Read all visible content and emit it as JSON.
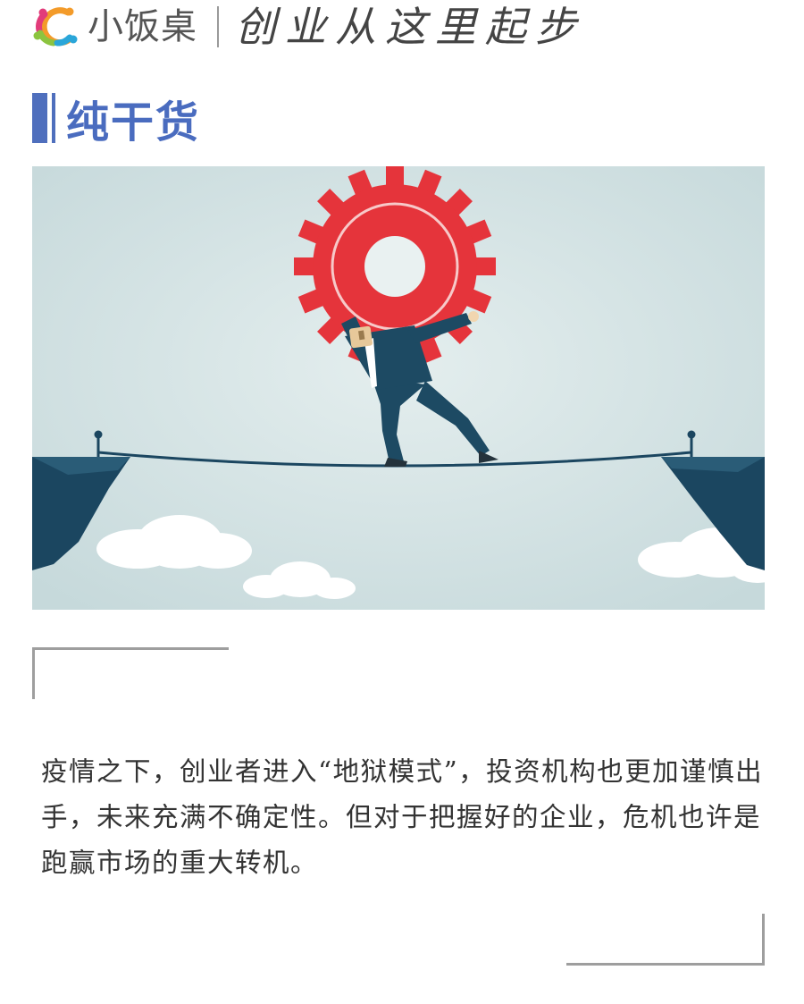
{
  "header": {
    "brand_name": "小饭桌",
    "slogan": "创业从这里起步",
    "logo_icon": "colorful-c-logo-icon"
  },
  "section": {
    "title": "纯干货"
  },
  "hero": {
    "icon": "businessman-carrying-gear-on-tightrope-illustration"
  },
  "article": {
    "paragraph": "疫情之下，创业者进入“地狱模式”，投资机构也更加谨慎出手，未来充满不确定性。但对于把握好的企业，危机也许是跑赢市场的重大转机。"
  },
  "colors": {
    "accent_blue": "#4a6cbf",
    "gear_red": "#e5343b",
    "suit_navy": "#1d4a63",
    "sky": "#cfe0e1",
    "frame_gray": "#9e9e9e"
  }
}
